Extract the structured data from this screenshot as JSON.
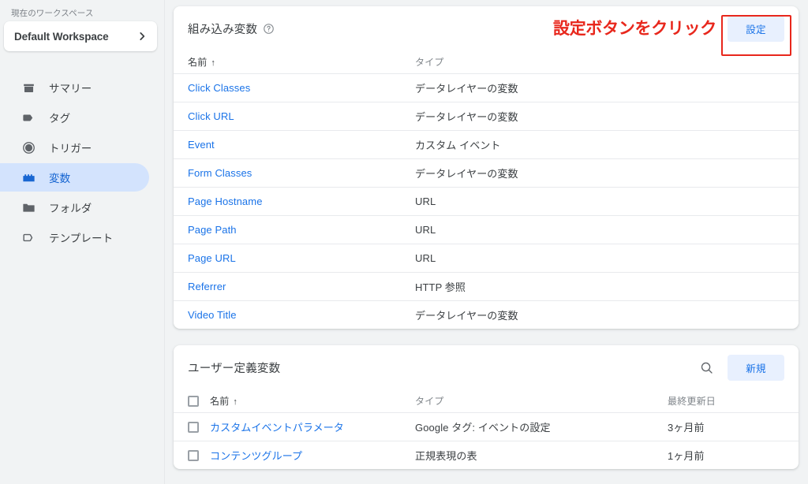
{
  "sidebar": {
    "workspace_label": "現在のワークスペース",
    "workspace_name": "Default Workspace",
    "chevron_icon": "chevron-right-icon",
    "items": [
      {
        "label": "サマリー",
        "icon": "summary-icon",
        "active": false
      },
      {
        "label": "タグ",
        "icon": "tag-icon",
        "active": false
      },
      {
        "label": "トリガー",
        "icon": "trigger-icon",
        "active": false
      },
      {
        "label": "変数",
        "icon": "variable-icon",
        "active": true
      },
      {
        "label": "フォルダ",
        "icon": "folder-icon",
        "active": false
      },
      {
        "label": "テンプレート",
        "icon": "template-icon",
        "active": false
      }
    ]
  },
  "builtin_card": {
    "title": "組み込み変数",
    "help_icon": "help-circle-icon",
    "annotation": "設定ボタンをクリック",
    "configure_button": "設定",
    "columns": [
      {
        "label": "名前",
        "sorted": true,
        "sort_arrow": "↑"
      },
      {
        "label": "タイプ",
        "sorted": false,
        "sort_arrow": ""
      }
    ],
    "rows": [
      {
        "name": "Click Classes",
        "type": "データレイヤーの変数"
      },
      {
        "name": "Click URL",
        "type": "データレイヤーの変数"
      },
      {
        "name": "Event",
        "type": "カスタム イベント"
      },
      {
        "name": "Form Classes",
        "type": "データレイヤーの変数"
      },
      {
        "name": "Page Hostname",
        "type": "URL"
      },
      {
        "name": "Page Path",
        "type": "URL"
      },
      {
        "name": "Page URL",
        "type": "URL"
      },
      {
        "name": "Referrer",
        "type": "HTTP 参照"
      },
      {
        "name": "Video Title",
        "type": "データレイヤーの変数"
      }
    ]
  },
  "userdefined_card": {
    "title": "ユーザー定義変数",
    "search_icon": "search-icon",
    "new_button": "新規",
    "columns": [
      {
        "label": "名前",
        "sorted": true,
        "sort_arrow": "↑"
      },
      {
        "label": "タイプ",
        "sorted": false,
        "sort_arrow": ""
      },
      {
        "label": "最終更新日",
        "sorted": false,
        "sort_arrow": ""
      }
    ],
    "rows": [
      {
        "name": "カスタムイベントパラメータ",
        "type": "Google タグ: イベントの設定",
        "updated": "3ヶ月前"
      },
      {
        "name": "コンテンツグループ",
        "type": "正規表現の表",
        "updated": "1ヶ月前"
      }
    ]
  },
  "colors": {
    "accent_blue": "#1a73e8",
    "active_pill": "#d3e3fd",
    "annotation_red": "#e8271c",
    "page_bg": "#f1f3f4",
    "card_bg": "#ffffff",
    "text_primary": "#3c4043",
    "text_secondary": "#80868b"
  }
}
